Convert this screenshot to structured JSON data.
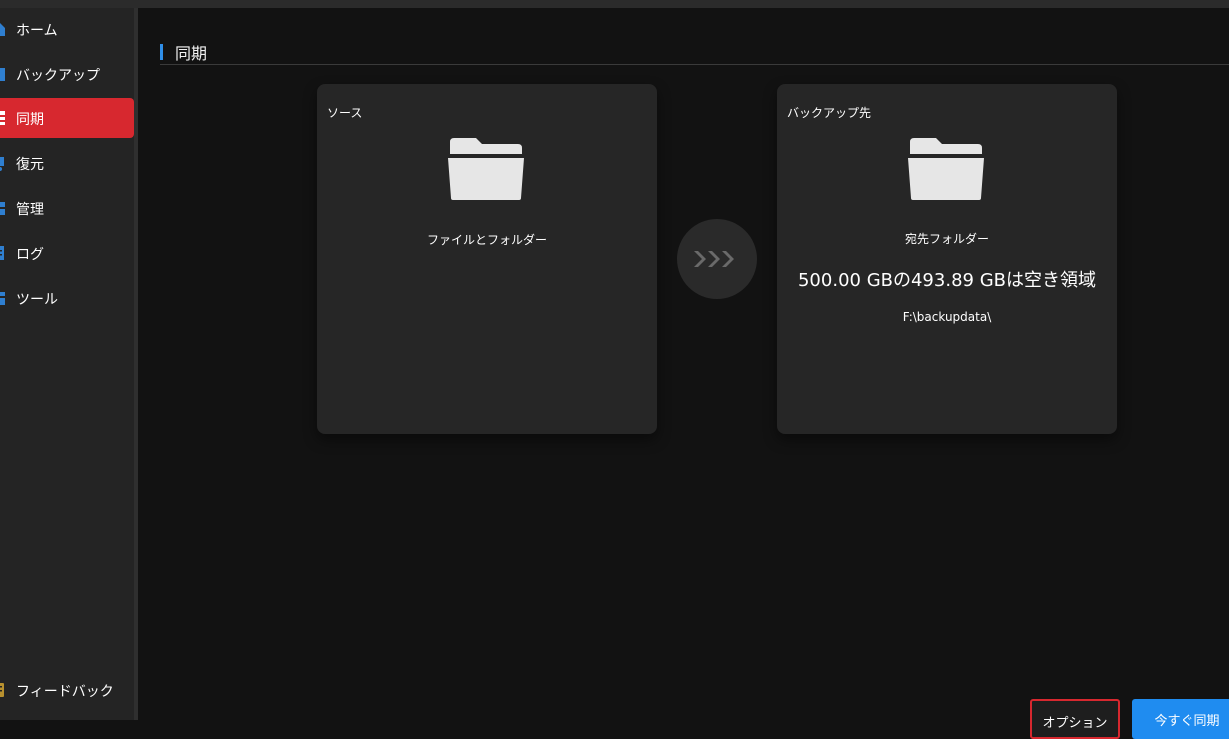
{
  "sidebar": {
    "items": [
      {
        "label": "ホーム",
        "icon": "home-icon",
        "active": false
      },
      {
        "label": "バックアップ",
        "icon": "backup-icon",
        "active": false
      },
      {
        "label": "同期",
        "icon": "sync-icon",
        "active": true
      },
      {
        "label": "復元",
        "icon": "restore-icon",
        "active": false
      },
      {
        "label": "管理",
        "icon": "manage-icon",
        "active": false
      },
      {
        "label": "ログ",
        "icon": "log-icon",
        "active": false
      },
      {
        "label": "ツール",
        "icon": "tools-icon",
        "active": false
      }
    ],
    "feedback": {
      "label": "フィードバック",
      "icon": "feedback-icon"
    }
  },
  "main": {
    "title": "同期",
    "source": {
      "label": "ソース",
      "subtitle": "ファイルとフォルダー",
      "icon": "folder-icon"
    },
    "destination": {
      "label": "バックアップ先",
      "subtitle": "宛先フォルダー",
      "space": "500.00 GBの493.89 GBは空き領域",
      "path": "F:\\backupdata\\",
      "icon": "folder-icon"
    },
    "arrow_icon": "triple-chevron-right-icon"
  },
  "footer": {
    "options_label": "オプション",
    "sync_label": "今すぐ同期"
  },
  "colors": {
    "accent_red": "#d7282f",
    "accent_blue": "#1f8cf0",
    "title_bar_blue": "#2f8ee8",
    "background": "#121212",
    "card": "#262626",
    "sidebar": "#242424"
  }
}
